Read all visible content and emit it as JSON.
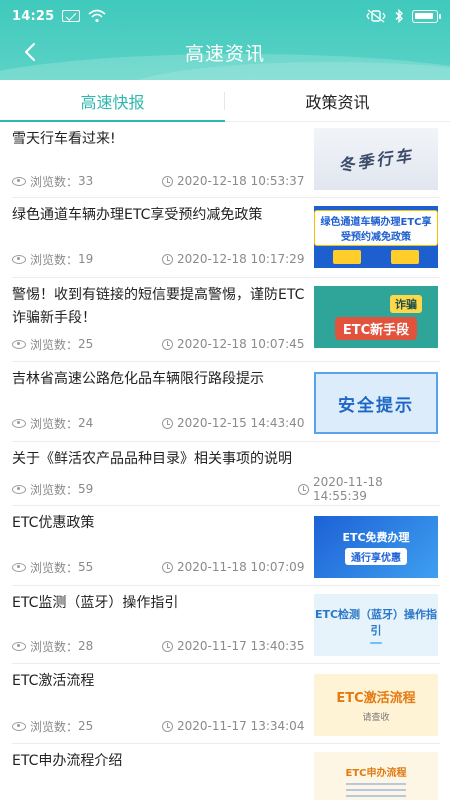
{
  "status_bar": {
    "time": "14:25"
  },
  "header": {
    "title": "高速资讯",
    "back_icon": "chevron-left-icon"
  },
  "tabs": [
    {
      "label": "高速快报",
      "active": true
    },
    {
      "label": "政策资讯",
      "active": false
    }
  ],
  "colors": {
    "header_bg": "#3fc9bc",
    "accent": "#2fb8ad",
    "meta_text": "#8a8a8a"
  },
  "news": [
    {
      "title": "雪天行车看过来!",
      "views_label": "浏览数：",
      "views": "33",
      "time": "2020-12-18 10:53:37",
      "thumb_text": "冬季行车"
    },
    {
      "title": "绿色通道车辆办理ETC享受预约减免政策",
      "views_label": "浏览数：",
      "views": "19",
      "time": "2020-12-18 10:17:29",
      "thumb_text": "绿色通道车辆办理ETC享受预约减免政策"
    },
    {
      "title": "警惕！收到有链接的短信要提高警惕，谨防ETC诈骗新手段！",
      "views_label": "浏览数：",
      "views": "25",
      "time": "2020-12-18 10:07:45",
      "thumb_tag": "诈骗",
      "thumb_text": "ETC新手段"
    },
    {
      "title": "吉林省高速公路危化品车辆限行路段提示",
      "views_label": "浏览数：",
      "views": "24",
      "time": "2020-12-15 14:43:40",
      "thumb_text": "安全提示"
    },
    {
      "title": "关于《鲜活农产品品种目录》相关事项的说明",
      "views_label": "浏览数：",
      "views": "59",
      "time": "2020-11-18 14:55:39"
    },
    {
      "title": "ETC优惠政策",
      "views_label": "浏览数：",
      "views": "55",
      "time": "2020-11-18 10:07:09",
      "thumb_text": "ETC免费办理",
      "thumb_sub": "通行享优惠"
    },
    {
      "title": "ETC监测（蓝牙）操作指引",
      "views_label": "浏览数：",
      "views": "28",
      "time": "2020-11-17 13:40:35",
      "thumb_text": "ETC检测（蓝牙）操作指引"
    },
    {
      "title": "ETC激活流程",
      "views_label": "浏览数：",
      "views": "25",
      "time": "2020-11-17 13:34:04",
      "thumb_text": "ETC激活流程",
      "thumb_sub": "请查收"
    },
    {
      "title": "ETC申办流程介绍",
      "thumb_text": "ETC申办流程"
    }
  ]
}
